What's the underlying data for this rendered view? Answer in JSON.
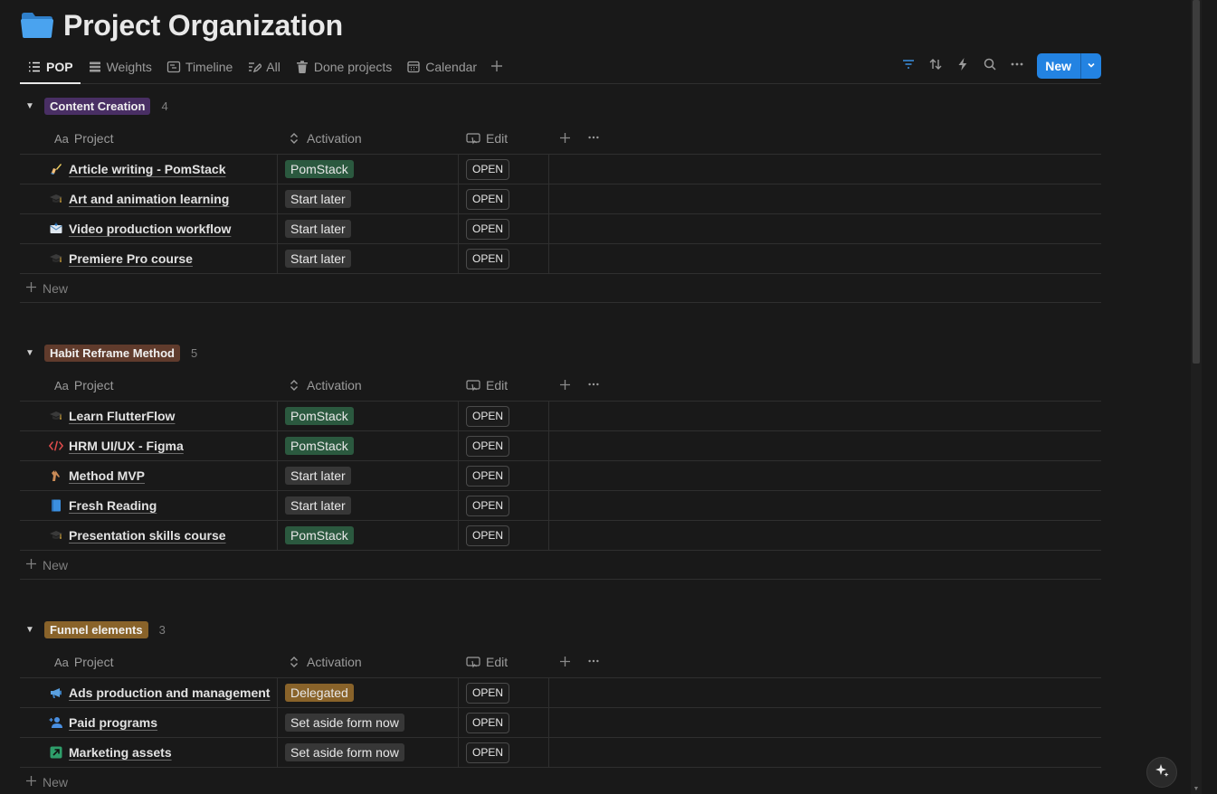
{
  "page": {
    "title": "Project Organization",
    "icon": "folder-icon"
  },
  "tabs": [
    {
      "label": "POP",
      "icon": "list-icon",
      "active": true
    },
    {
      "label": "Weights",
      "icon": "table-icon"
    },
    {
      "label": "Timeline",
      "icon": "timeline-icon"
    },
    {
      "label": "All",
      "icon": "edit-icon"
    },
    {
      "label": "Done projects",
      "icon": "trash-icon"
    },
    {
      "label": "Calendar",
      "icon": "calendar-icon"
    }
  ],
  "toolbar": {
    "new_label": "New"
  },
  "columns": {
    "project": "Project",
    "activation": "Activation",
    "edit": "Edit",
    "project_prefix": "Aa"
  },
  "add_row_label": "New",
  "colors": {
    "pomstack": "#2b593f",
    "start_later": "#373737",
    "delegated": "#89632a",
    "set_aside": "#373737",
    "group_content": "#492f64",
    "group_habit": "#603b2c",
    "group_funnel": "#89632a",
    "accent": "#2383e2"
  },
  "groups": [
    {
      "label": "Content Creation",
      "count": "4",
      "color": "#492f64",
      "rows": [
        {
          "icon": "writing-hand-icon",
          "title": "Article writing - PomStack",
          "activation": "PomStack",
          "edit": "OPEN"
        },
        {
          "icon": "graduation-cap-icon",
          "title": "Art and animation learning",
          "activation": "Start later",
          "edit": "OPEN"
        },
        {
          "icon": "envelope-icon",
          "title": "Video production workflow",
          "activation": "Start later",
          "edit": "OPEN"
        },
        {
          "icon": "graduation-cap-icon",
          "title": "Premiere Pro course",
          "activation": "Start later",
          "edit": "OPEN"
        }
      ]
    },
    {
      "label": "Habit Reframe Method",
      "count": "5",
      "color": "#603b2c",
      "rows": [
        {
          "icon": "graduation-cap-icon",
          "title": "Learn FlutterFlow",
          "activation": "PomStack",
          "edit": "OPEN"
        },
        {
          "icon": "code-icon",
          "title": "HRM UI/UX - Figma",
          "activation": "PomStack",
          "edit": "OPEN"
        },
        {
          "icon": "horse-icon",
          "title": "Method MVP",
          "activation": "Start later",
          "edit": "OPEN"
        },
        {
          "icon": "book-icon",
          "title": "Fresh Reading",
          "activation": "Start later",
          "edit": "OPEN"
        },
        {
          "icon": "graduation-cap-icon",
          "title": "Presentation skills course",
          "activation": "PomStack",
          "edit": "OPEN"
        }
      ]
    },
    {
      "label": "Funnel elements",
      "count": "3",
      "color": "#89632a",
      "rows": [
        {
          "icon": "megaphone-icon",
          "title": "Ads production and management",
          "activation": "Delegated",
          "edit": "OPEN"
        },
        {
          "icon": "user-add-icon",
          "title": "Paid programs",
          "activation": "Set aside form now",
          "edit": "OPEN"
        },
        {
          "icon": "arrow-up-right-icon",
          "title": "Marketing assets",
          "activation": "Set aside form now",
          "edit": "OPEN"
        }
      ]
    }
  ]
}
